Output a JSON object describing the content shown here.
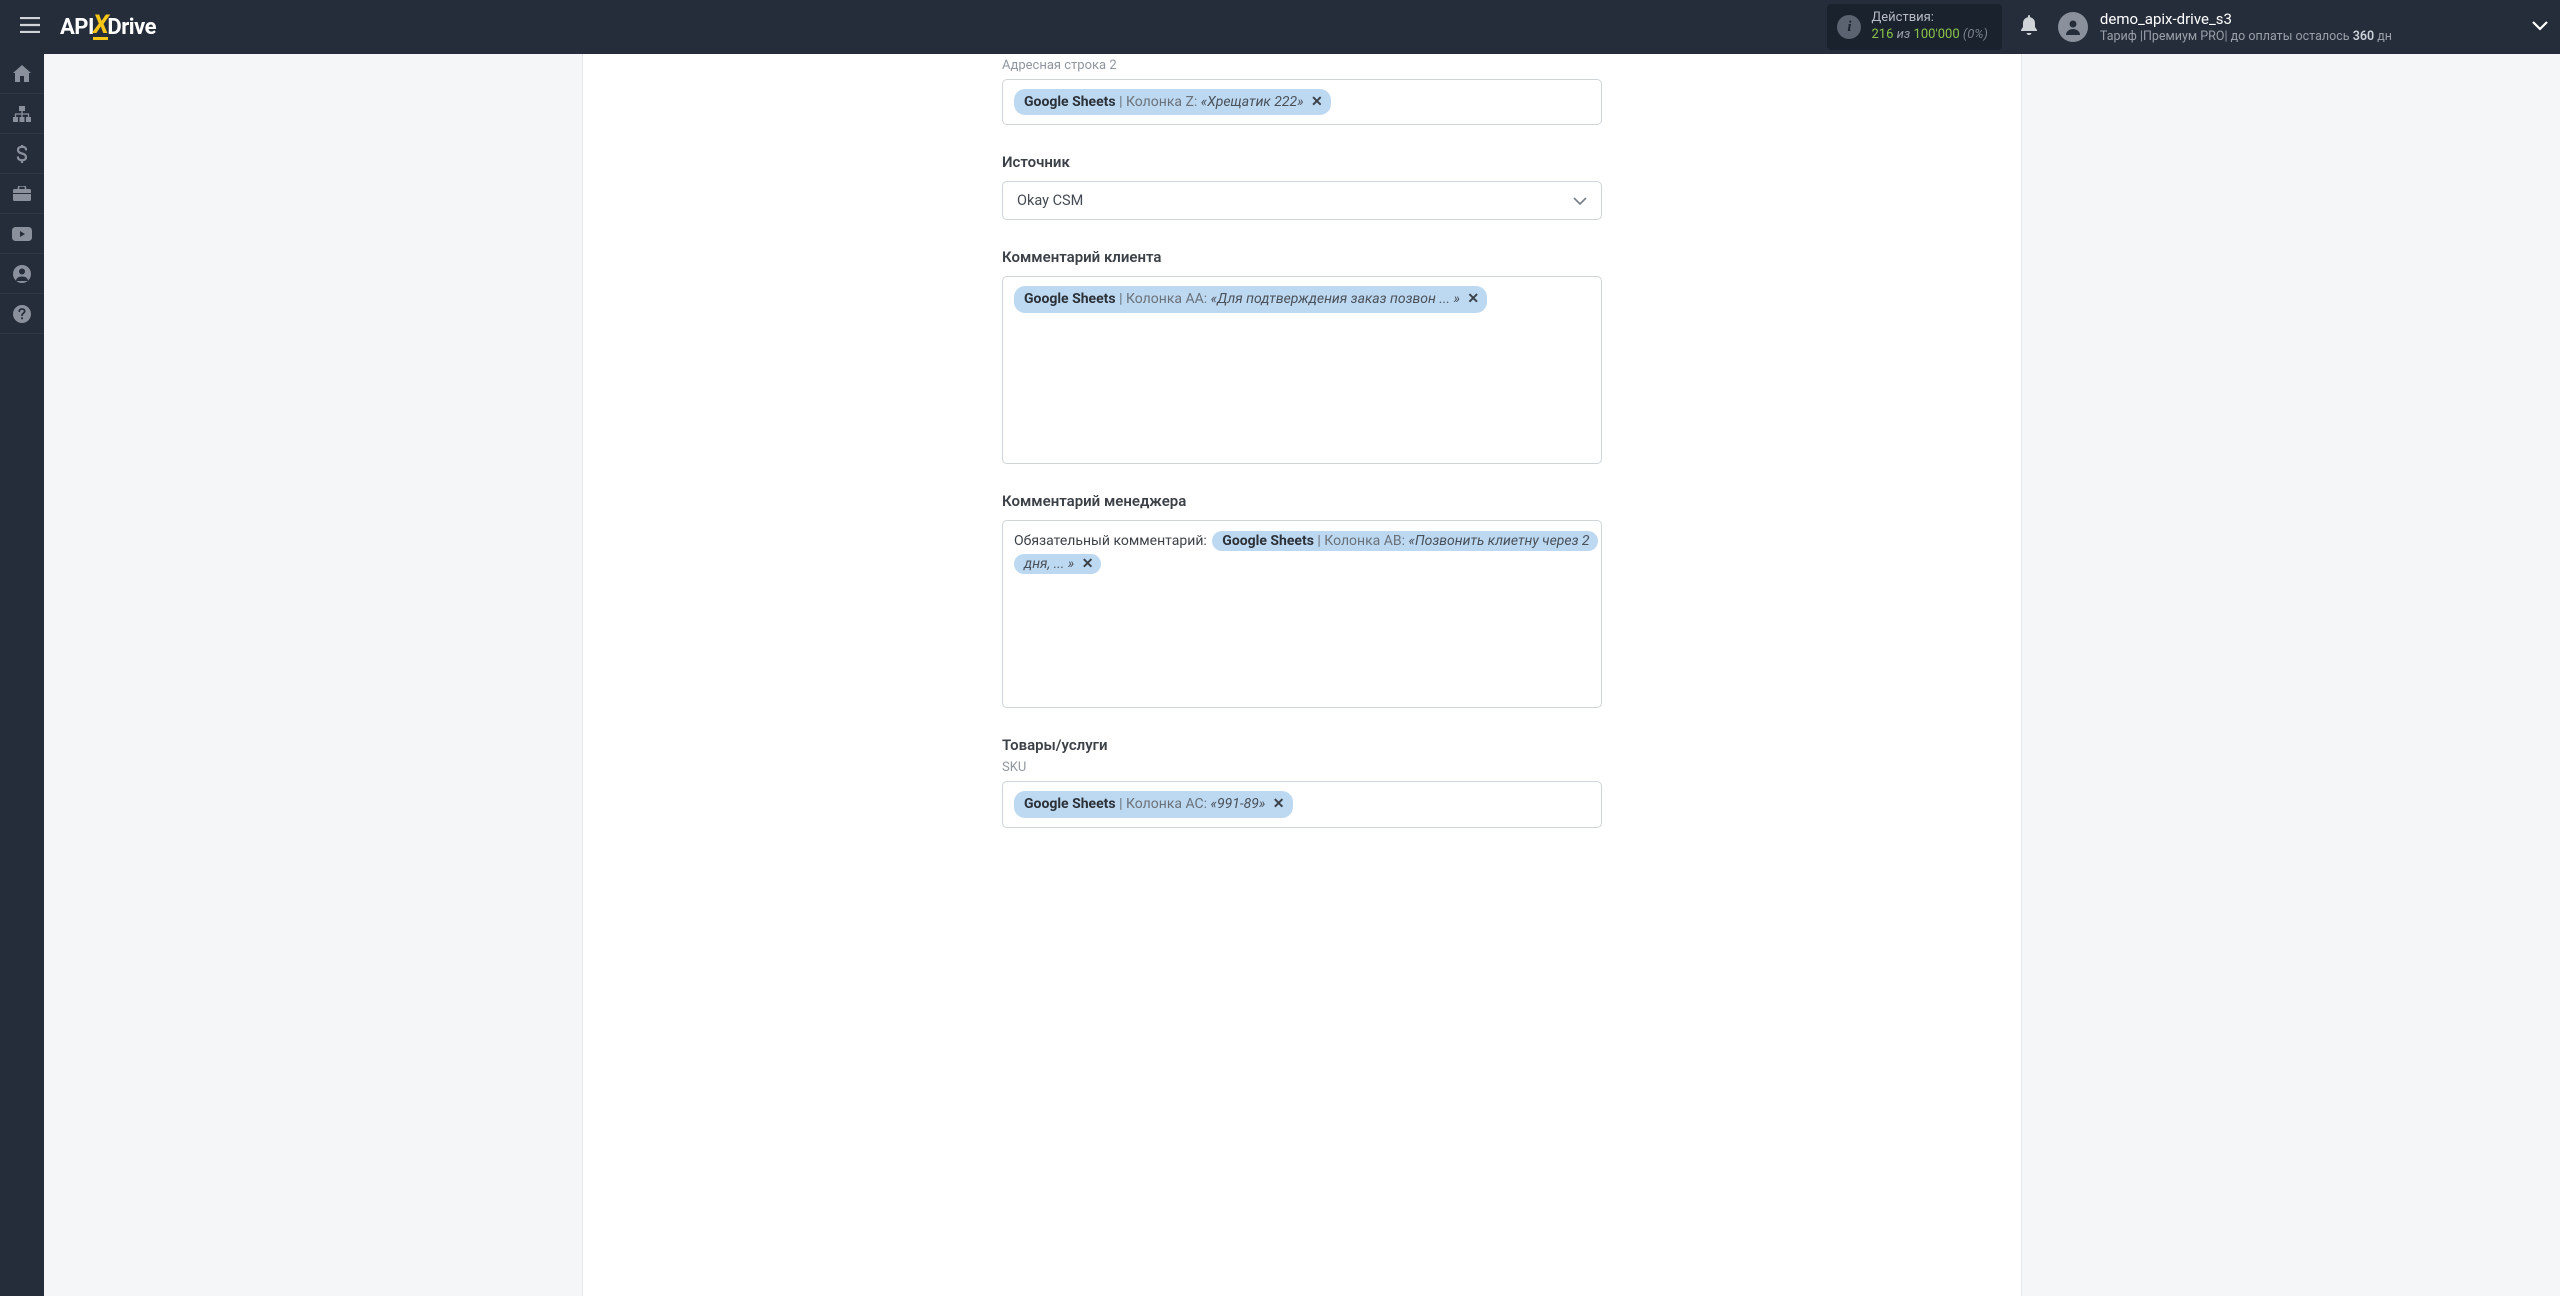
{
  "header": {
    "logo": {
      "part1": "API",
      "part2": "X",
      "part3": "Drive"
    },
    "actions": {
      "label": "Действия:",
      "count": "216",
      "of": "из",
      "max": "100'000",
      "pct": "(0%)"
    },
    "user": {
      "name": "demo_apix-drive_s3",
      "tariff_label": "Тариф",
      "tariff_name": "Премиум PRO",
      "pay_label": "до оплаты осталось",
      "pay_days": "360",
      "pay_unit": "дн"
    }
  },
  "form": {
    "address2": {
      "sublabel": "Адресная строка 2",
      "tag": {
        "source": "Google Sheets",
        "column": "Колонка Z:",
        "value": "«Хрещатик 222»"
      }
    },
    "source": {
      "label": "Источник",
      "selected": "Okay CSM"
    },
    "client_comment": {
      "label": "Комментарий клиента",
      "tag": {
        "source": "Google Sheets",
        "column": "Колонка AA:",
        "value": "«Для подтверждения заказ позвон ... »"
      }
    },
    "manager_comment": {
      "label": "Комментарий менеджера",
      "prefix": "Обязательный комментарий: ",
      "tag": {
        "source": "Google Sheets",
        "column": "Колонка AB:",
        "value": "«Позвонить клиетну через 2 дня, ... »"
      }
    },
    "goods": {
      "label": "Товары/услуги",
      "sublabel": "SKU",
      "tag": {
        "source": "Google Sheets",
        "column": "Колонка AC:",
        "value": "«991-89»"
      }
    }
  }
}
